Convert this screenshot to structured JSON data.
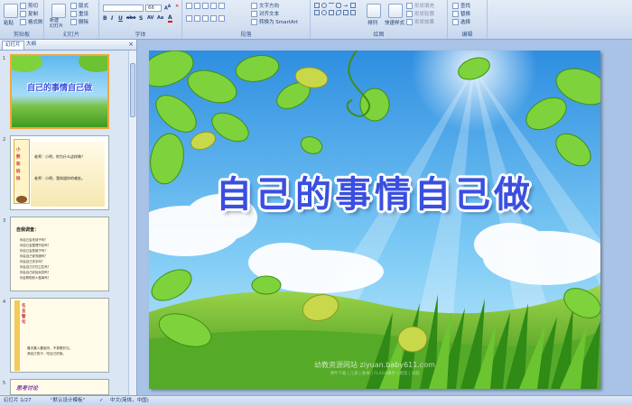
{
  "ribbon": {
    "clipboard": {
      "paste": "粘贴",
      "cut": "剪切",
      "copy": "复制",
      "format_painter": "格式刷",
      "label": "剪贴板"
    },
    "slides": {
      "new_slide": "新建\n幻灯片",
      "layout": "版式",
      "reset": "重设",
      "delete": "删除",
      "label": "幻灯片"
    },
    "font": {
      "size": "66",
      "label": "字体",
      "bold": "B",
      "italic": "I",
      "underline": "U",
      "strike": "abe",
      "shadow": "S",
      "spacing": "AV",
      "case": "Aa",
      "color": "A"
    },
    "paragraph": {
      "text_direction": "文字方向",
      "align_text": "对齐文本",
      "smartart": "转换为 SmartArt",
      "label": "段落"
    },
    "drawing": {
      "arrange": "排列",
      "quick_styles": "快速样式",
      "shape_fill": "形状填充",
      "shape_outline": "形状轮廓",
      "shape_effects": "形状效果",
      "label": "绘图"
    },
    "editing": {
      "find": "查找",
      "replace": "替换",
      "select": "选择",
      "label": "编辑"
    }
  },
  "left_pane": {
    "tabs": [
      "幻灯片",
      "大纲"
    ],
    "slides": [
      {
        "number": "1",
        "title": "自己的事情自己做"
      },
      {
        "number": "2",
        "lines": [
          "小",
          "熊",
          "和",
          "妈",
          "妈"
        ],
        "dialog": [
          "老师：小明，你为什么这样做？",
          "老师：小明，我知道你的难处。"
        ]
      },
      {
        "number": "3",
        "heading": "自我调查：",
        "items": [
          "你自己会洗袜子吗？",
          "你自己会整理书包吗？",
          "你自己会叠被子吗？",
          "你会自己穿衣服吗？",
          "你会自己洗手吗？",
          "你会自己打扫卫生吗？",
          "你会自己收拾玩具吗？",
          "你会帮助别人做事吗？"
        ]
      },
      {
        "number": "4",
        "heading": "名言警句",
        "text": [
          "靠天靠人靠祖宗，不算是好汉。",
          "滴自己的汗，吃自己的饭。"
        ]
      },
      {
        "number": "5",
        "heading": "思考讨论"
      }
    ]
  },
  "slide": {
    "title": "自己的事情自己做",
    "watermark": "幼教资源网站  ziyuan.baby611.com",
    "watermark_sub": "课件下载 | 儿歌 | 故事 | FLASH课件 | 教案 | 试题"
  },
  "status": {
    "slide_info": "幻灯片 1/27",
    "theme": "\"默认设计模板\"",
    "language": "中文(简体，中国)"
  },
  "colors": {
    "accent": "#f3a738",
    "title": "#3a4fe0",
    "sky": "#3ea3ec",
    "grass": "#3f9a1f"
  }
}
